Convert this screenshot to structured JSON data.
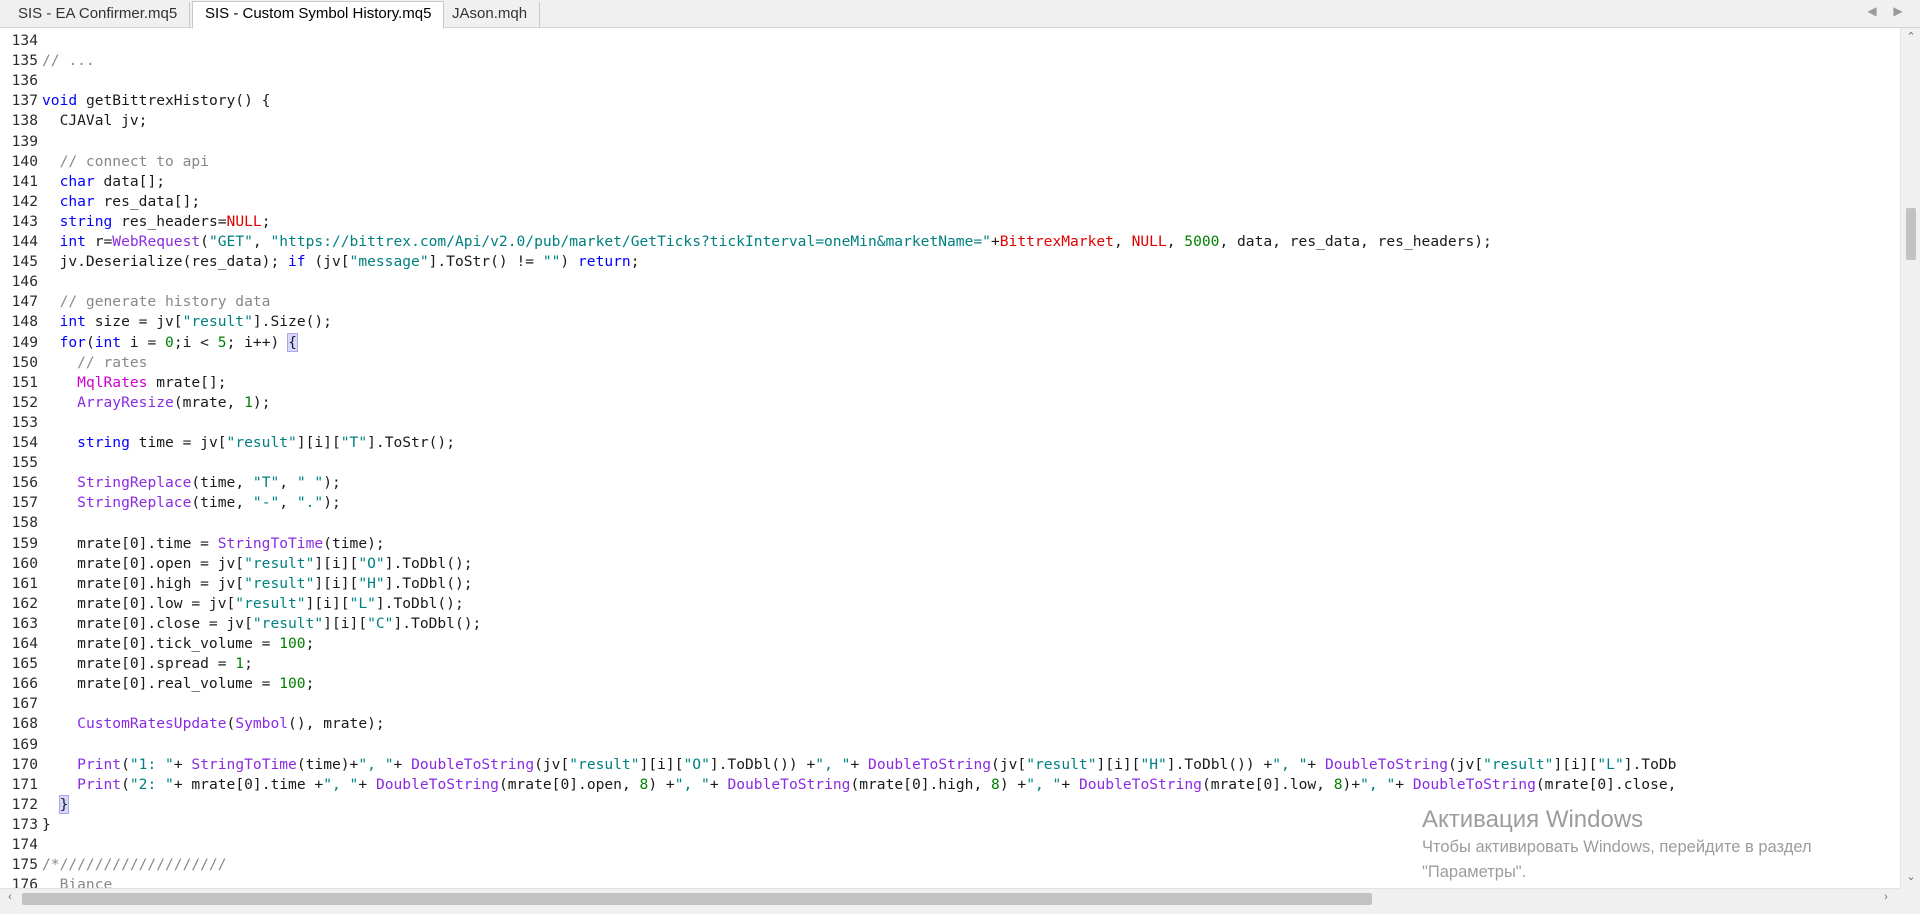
{
  "tabs": [
    {
      "label": "SIS - EA Confirmer.mq5",
      "active": false
    },
    {
      "label": "SIS - Custom Symbol History.mq5",
      "active": true
    },
    {
      "label": "JAson.mqh",
      "active": false
    }
  ],
  "code_lines": [
    {
      "n": "134",
      "s": []
    },
    {
      "n": "135",
      "s": [
        {
          "t": "// ...",
          "c": "cm"
        }
      ]
    },
    {
      "n": "136",
      "s": []
    },
    {
      "n": "137",
      "s": [
        {
          "t": "void",
          "c": "kw"
        },
        {
          "t": " getBittrexHistory() {"
        }
      ]
    },
    {
      "n": "138",
      "s": [
        {
          "t": "  CJAVal jv;"
        }
      ]
    },
    {
      "n": "139",
      "s": []
    },
    {
      "n": "140",
      "s": [
        {
          "t": "  // connect to api",
          "c": "cm"
        }
      ]
    },
    {
      "n": "141",
      "s": [
        {
          "t": "  "
        },
        {
          "t": "char",
          "c": "kw"
        },
        {
          "t": " data[];"
        }
      ]
    },
    {
      "n": "142",
      "s": [
        {
          "t": "  "
        },
        {
          "t": "char",
          "c": "kw"
        },
        {
          "t": " res_data[];"
        }
      ]
    },
    {
      "n": "143",
      "s": [
        {
          "t": "  "
        },
        {
          "t": "string",
          "c": "kw"
        },
        {
          "t": " res_headers="
        },
        {
          "t": "NULL",
          "c": "red"
        },
        {
          "t": ";"
        }
      ]
    },
    {
      "n": "144",
      "s": [
        {
          "t": "  "
        },
        {
          "t": "int",
          "c": "kw"
        },
        {
          "t": " r="
        },
        {
          "t": "WebRequest",
          "c": "fn"
        },
        {
          "t": "("
        },
        {
          "t": "\"GET\"",
          "c": "str"
        },
        {
          "t": ", "
        },
        {
          "t": "\"https://bittrex.com/Api/v2.0/pub/market/GetTicks?tickInterval=oneMin&marketName=\"",
          "c": "str"
        },
        {
          "t": "+"
        },
        {
          "t": "BittrexMarket",
          "c": "red"
        },
        {
          "t": ", "
        },
        {
          "t": "NULL",
          "c": "red"
        },
        {
          "t": ", "
        },
        {
          "t": "5000",
          "c": "num"
        },
        {
          "t": ", data, res_data, res_headers);"
        }
      ]
    },
    {
      "n": "145",
      "s": [
        {
          "t": "  jv.Deserialize(res_data); "
        },
        {
          "t": "if",
          "c": "kw"
        },
        {
          "t": " (jv["
        },
        {
          "t": "\"message\"",
          "c": "str"
        },
        {
          "t": "].ToStr() != "
        },
        {
          "t": "\"\"",
          "c": "str"
        },
        {
          "t": ") "
        },
        {
          "t": "return",
          "c": "kw"
        },
        {
          "t": ";"
        }
      ]
    },
    {
      "n": "146",
      "s": []
    },
    {
      "n": "147",
      "s": [
        {
          "t": "  // generate history data",
          "c": "cm"
        }
      ]
    },
    {
      "n": "148",
      "s": [
        {
          "t": "  "
        },
        {
          "t": "int",
          "c": "kw"
        },
        {
          "t": " size = jv["
        },
        {
          "t": "\"result\"",
          "c": "str"
        },
        {
          "t": "].Size();"
        }
      ]
    },
    {
      "n": "149",
      "s": [
        {
          "t": "  "
        },
        {
          "t": "for",
          "c": "kw"
        },
        {
          "t": "("
        },
        {
          "t": "int",
          "c": "kw"
        },
        {
          "t": " i = "
        },
        {
          "t": "0",
          "c": "num"
        },
        {
          "t": ";i < "
        },
        {
          "t": "5",
          "c": "num"
        },
        {
          "t": "; i++) "
        },
        {
          "t": "{",
          "c": "br"
        }
      ]
    },
    {
      "n": "150",
      "s": [
        {
          "t": "    // rates",
          "c": "cm"
        }
      ]
    },
    {
      "n": "151",
      "s": [
        {
          "t": "    "
        },
        {
          "t": "MqlRates",
          "c": "ty"
        },
        {
          "t": " mrate[];"
        }
      ]
    },
    {
      "n": "152",
      "s": [
        {
          "t": "    "
        },
        {
          "t": "ArrayResize",
          "c": "fn"
        },
        {
          "t": "(mrate, "
        },
        {
          "t": "1",
          "c": "num"
        },
        {
          "t": ");"
        }
      ]
    },
    {
      "n": "153",
      "s": []
    },
    {
      "n": "154",
      "s": [
        {
          "t": "    "
        },
        {
          "t": "string",
          "c": "kw"
        },
        {
          "t": " time = jv["
        },
        {
          "t": "\"result\"",
          "c": "str"
        },
        {
          "t": "][i]["
        },
        {
          "t": "\"T\"",
          "c": "str"
        },
        {
          "t": "].ToStr();"
        }
      ]
    },
    {
      "n": "155",
      "s": []
    },
    {
      "n": "156",
      "s": [
        {
          "t": "    "
        },
        {
          "t": "StringReplace",
          "c": "fn"
        },
        {
          "t": "(time, "
        },
        {
          "t": "\"T\"",
          "c": "str"
        },
        {
          "t": ", "
        },
        {
          "t": "\" \"",
          "c": "str"
        },
        {
          "t": ");"
        }
      ]
    },
    {
      "n": "157",
      "s": [
        {
          "t": "    "
        },
        {
          "t": "StringReplace",
          "c": "fn"
        },
        {
          "t": "(time, "
        },
        {
          "t": "\"-\"",
          "c": "str"
        },
        {
          "t": ", "
        },
        {
          "t": "\".\"",
          "c": "str"
        },
        {
          "t": ");"
        }
      ]
    },
    {
      "n": "158",
      "s": []
    },
    {
      "n": "159",
      "s": [
        {
          "t": "    mrate[0].time = "
        },
        {
          "t": "StringToTime",
          "c": "fn"
        },
        {
          "t": "(time);"
        }
      ]
    },
    {
      "n": "160",
      "s": [
        {
          "t": "    mrate[0].open = jv["
        },
        {
          "t": "\"result\"",
          "c": "str"
        },
        {
          "t": "][i]["
        },
        {
          "t": "\"O\"",
          "c": "str"
        },
        {
          "t": "].ToDbl();"
        }
      ]
    },
    {
      "n": "161",
      "s": [
        {
          "t": "    mrate[0].high = jv["
        },
        {
          "t": "\"result\"",
          "c": "str"
        },
        {
          "t": "][i]["
        },
        {
          "t": "\"H\"",
          "c": "str"
        },
        {
          "t": "].ToDbl();"
        }
      ]
    },
    {
      "n": "162",
      "s": [
        {
          "t": "    mrate[0].low = jv["
        },
        {
          "t": "\"result\"",
          "c": "str"
        },
        {
          "t": "][i]["
        },
        {
          "t": "\"L\"",
          "c": "str"
        },
        {
          "t": "].ToDbl();"
        }
      ]
    },
    {
      "n": "163",
      "s": [
        {
          "t": "    mrate[0].close = jv["
        },
        {
          "t": "\"result\"",
          "c": "str"
        },
        {
          "t": "][i]["
        },
        {
          "t": "\"C\"",
          "c": "str"
        },
        {
          "t": "].ToDbl();"
        }
      ]
    },
    {
      "n": "164",
      "s": [
        {
          "t": "    mrate[0].tick_volume = "
        },
        {
          "t": "100",
          "c": "num"
        },
        {
          "t": ";"
        }
      ]
    },
    {
      "n": "165",
      "s": [
        {
          "t": "    mrate[0].spread = "
        },
        {
          "t": "1",
          "c": "num"
        },
        {
          "t": ";"
        }
      ]
    },
    {
      "n": "166",
      "s": [
        {
          "t": "    mrate[0].real_volume = "
        },
        {
          "t": "100",
          "c": "num"
        },
        {
          "t": ";"
        }
      ]
    },
    {
      "n": "167",
      "s": []
    },
    {
      "n": "168",
      "s": [
        {
          "t": "    "
        },
        {
          "t": "CustomRatesUpdate",
          "c": "fn"
        },
        {
          "t": "("
        },
        {
          "t": "Symbol",
          "c": "fn"
        },
        {
          "t": "(), mrate);"
        }
      ]
    },
    {
      "n": "169",
      "s": []
    },
    {
      "n": "170",
      "s": [
        {
          "t": "    "
        },
        {
          "t": "Print",
          "c": "fn"
        },
        {
          "t": "("
        },
        {
          "t": "\"1: \"",
          "c": "str"
        },
        {
          "t": "+ "
        },
        {
          "t": "StringToTime",
          "c": "fn"
        },
        {
          "t": "(time)+"
        },
        {
          "t": "\", \"",
          "c": "str"
        },
        {
          "t": "+ "
        },
        {
          "t": "DoubleToString",
          "c": "fn"
        },
        {
          "t": "(jv["
        },
        {
          "t": "\"result\"",
          "c": "str"
        },
        {
          "t": "][i]["
        },
        {
          "t": "\"O\"",
          "c": "str"
        },
        {
          "t": "].ToDbl()) +"
        },
        {
          "t": "\", \"",
          "c": "str"
        },
        {
          "t": "+ "
        },
        {
          "t": "DoubleToString",
          "c": "fn"
        },
        {
          "t": "(jv["
        },
        {
          "t": "\"result\"",
          "c": "str"
        },
        {
          "t": "][i]["
        },
        {
          "t": "\"H\"",
          "c": "str"
        },
        {
          "t": "].ToDbl()) +"
        },
        {
          "t": "\", \"",
          "c": "str"
        },
        {
          "t": "+ "
        },
        {
          "t": "DoubleToString",
          "c": "fn"
        },
        {
          "t": "(jv["
        },
        {
          "t": "\"result\"",
          "c": "str"
        },
        {
          "t": "][i]["
        },
        {
          "t": "\"L\"",
          "c": "str"
        },
        {
          "t": "].ToDb"
        }
      ]
    },
    {
      "n": "171",
      "s": [
        {
          "t": "    "
        },
        {
          "t": "Print",
          "c": "fn"
        },
        {
          "t": "("
        },
        {
          "t": "\"2: \"",
          "c": "str"
        },
        {
          "t": "+ mrate[0].time +"
        },
        {
          "t": "\", \"",
          "c": "str"
        },
        {
          "t": "+ "
        },
        {
          "t": "DoubleToString",
          "c": "fn"
        },
        {
          "t": "(mrate[0].open, "
        },
        {
          "t": "8",
          "c": "num"
        },
        {
          "t": ") +"
        },
        {
          "t": "\", \"",
          "c": "str"
        },
        {
          "t": "+ "
        },
        {
          "t": "DoubleToString",
          "c": "fn"
        },
        {
          "t": "(mrate[0].high, "
        },
        {
          "t": "8",
          "c": "num"
        },
        {
          "t": ") +"
        },
        {
          "t": "\", \"",
          "c": "str"
        },
        {
          "t": "+ "
        },
        {
          "t": "DoubleToString",
          "c": "fn"
        },
        {
          "t": "(mrate[0].low, "
        },
        {
          "t": "8",
          "c": "num"
        },
        {
          "t": ")+"
        },
        {
          "t": "\", \"",
          "c": "str"
        },
        {
          "t": "+ "
        },
        {
          "t": "DoubleToString",
          "c": "fn"
        },
        {
          "t": "(mrate[0].close,"
        }
      ]
    },
    {
      "n": "172",
      "s": [
        {
          "t": "  "
        },
        {
          "t": "}",
          "c": "br"
        }
      ]
    },
    {
      "n": "173",
      "s": [
        {
          "t": "}"
        }
      ]
    },
    {
      "n": "174",
      "s": []
    },
    {
      "n": "175",
      "s": [
        {
          "t": "/*///////////////////",
          "c": "cm"
        }
      ]
    },
    {
      "n": "176",
      "s": [
        {
          "t": "  Biance",
          "c": "cm"
        }
      ]
    }
  ],
  "watermark": {
    "title": "Активация Windows",
    "line1": "Чтобы активировать Windows, перейдите в раздел",
    "line2": "\"Параметры\"."
  },
  "icons": {
    "tab_prev": "chevron-left-icon",
    "tab_next": "chevron-right-icon",
    "scroll_up": "arrow-up-icon",
    "scroll_down": "arrow-down-icon",
    "scroll_left": "arrow-left-icon",
    "scroll_right": "arrow-right-icon"
  },
  "scroll": {
    "vertical_position": 0.18,
    "horizontal_visible": 0.72
  }
}
